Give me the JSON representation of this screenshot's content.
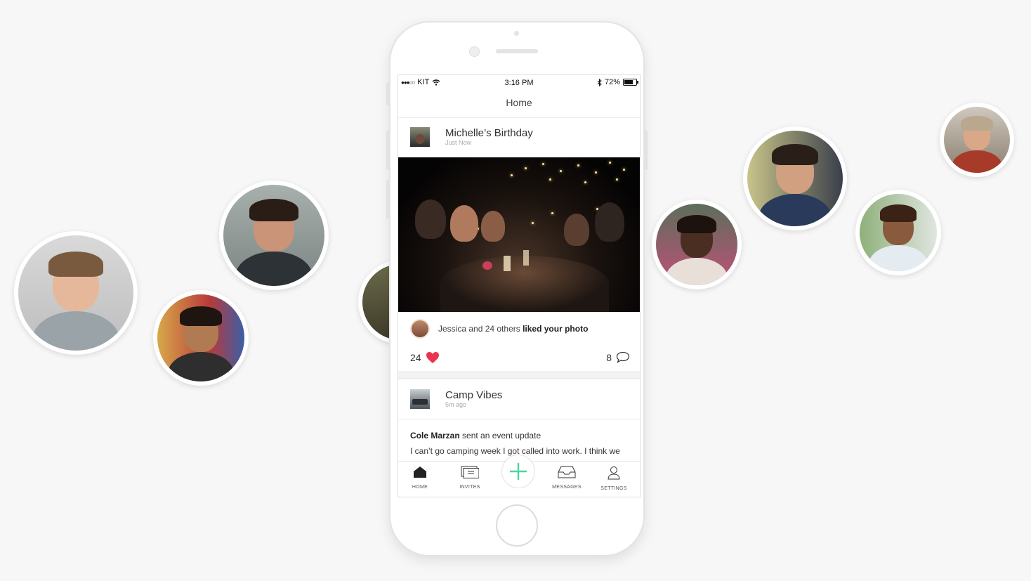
{
  "statusbar": {
    "carrier": "KIT",
    "time": "3:16 PM",
    "battery": "72%",
    "battery_level": 0.72
  },
  "nav": {
    "title": "Home"
  },
  "posts": [
    {
      "title": "Michelle’s Birthday",
      "time": "Just Now",
      "likes_text_prefix": "Jessica and 24 others ",
      "likes_text_bold": "liked your photo",
      "like_count": "24",
      "comment_count": "8"
    },
    {
      "title": "Camp Vibes",
      "time": "5m ago",
      "update_author": "Cole Marzan",
      "update_action": " sent an event update",
      "update_body": "I can’t go camping week I got called into work. I think we are rescheduling"
    }
  ],
  "tabs": {
    "home": "HOME",
    "invites": "INVITES",
    "messages": "MESSAGES",
    "settings": "SETTINGS"
  },
  "colors": {
    "accent": "#4cd6a0",
    "heart": "#e8344c",
    "background": "#f7f7f7"
  }
}
